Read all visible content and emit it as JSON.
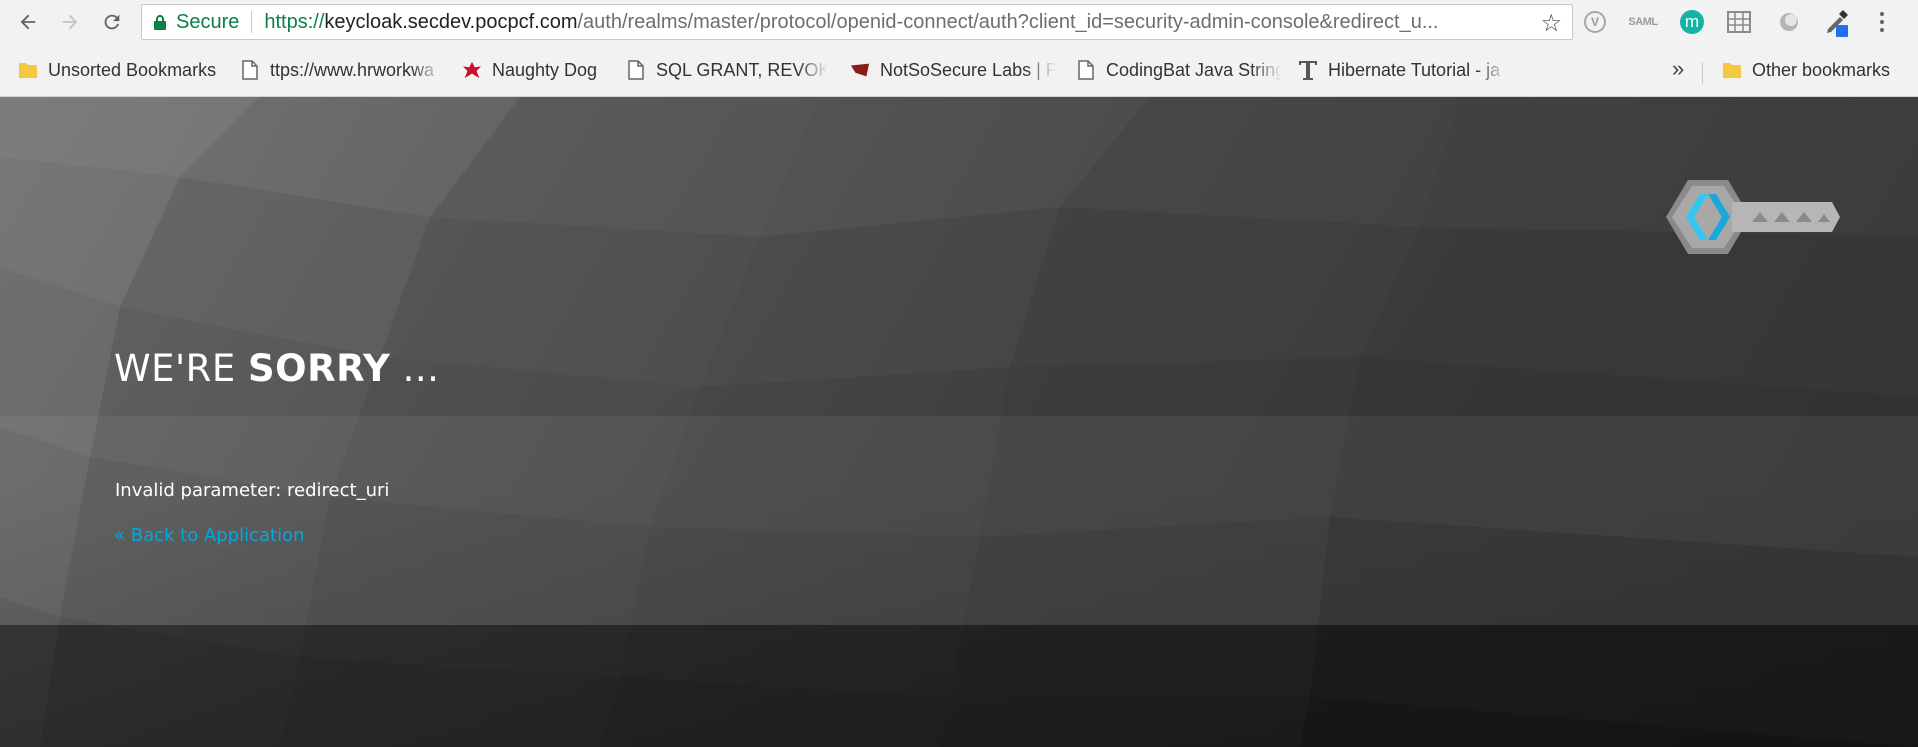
{
  "browser": {
    "omnibox": {
      "secure_label": "Secure",
      "url_scheme": "https://",
      "url_host": "keycloak.secdev.pocpcf.com",
      "url_path": "/auth/realms/master/protocol/openid-connect/auth?client_id=security-admin-console&redirect_u..."
    },
    "extensions": {
      "v_label": "V",
      "saml_label": "SAML",
      "m_label": "m"
    },
    "bookmarks": [
      {
        "label": "Unsorted Bookmarks",
        "icon": "folder-icon"
      },
      {
        "label": "ttps://www.hrworkwa",
        "icon": "page-icon"
      },
      {
        "label": "Naughty Dog",
        "icon": "naughty-dog-icon"
      },
      {
        "label": "SQL GRANT, REVOKE",
        "icon": "page-icon"
      },
      {
        "label": "NotSoSecure Labs | F",
        "icon": "notsosecure-icon"
      },
      {
        "label": "CodingBat Java String",
        "icon": "page-icon"
      },
      {
        "label": "Hibernate Tutorial - ja",
        "icon": "t-icon"
      }
    ],
    "more_label": "»",
    "other_bookmarks": "Other bookmarks"
  },
  "page": {
    "title_light": "WE'RE ",
    "title_bold": "SORRY",
    "title_tail": " ...",
    "error_message": "Invalid parameter: redirect_uri",
    "back_link": "« Back to Application"
  },
  "colors": {
    "secure_green": "#0b8043",
    "link_blue": "#00a7e1",
    "logo_cyan": "#33c6f0"
  }
}
